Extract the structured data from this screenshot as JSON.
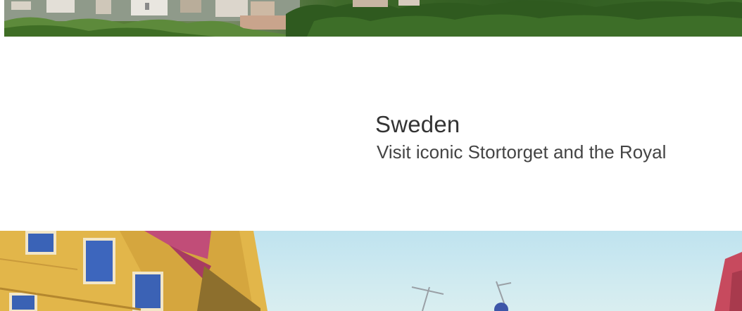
{
  "card": {
    "title": "Sweden",
    "description": "Visit iconic Stortorget and the Royal"
  },
  "images": {
    "top": "city-hillside-photo",
    "bottom": "old-town-facades-photo"
  }
}
